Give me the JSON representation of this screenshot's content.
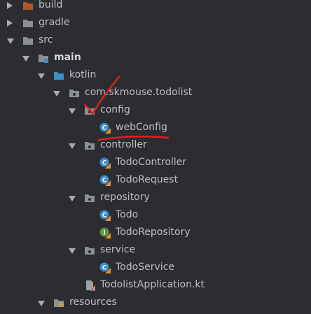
{
  "tree": {
    "nodes": [
      {
        "label": "build",
        "arrow": "collapsed",
        "icon": "folder-excluded-icon",
        "bold": false
      },
      {
        "label": "gradle",
        "arrow": "collapsed",
        "icon": "folder-icon",
        "bold": false
      },
      {
        "label": "src",
        "arrow": "expanded",
        "icon": "folder-icon",
        "bold": false
      },
      {
        "label": "main",
        "arrow": "expanded",
        "icon": "module-folder-icon",
        "bold": true
      },
      {
        "label": "kotlin",
        "arrow": "expanded",
        "icon": "source-folder-icon",
        "bold": false
      },
      {
        "label": "com.skmouse.todolist",
        "arrow": "expanded",
        "icon": "package-icon",
        "bold": false
      },
      {
        "label": "config",
        "arrow": "expanded",
        "icon": "package-icon",
        "bold": false
      },
      {
        "label": "webConfig",
        "arrow": "none",
        "icon": "kotlin-class-icon",
        "bold": false
      },
      {
        "label": "controller",
        "arrow": "expanded",
        "icon": "package-icon",
        "bold": false
      },
      {
        "label": "TodoController",
        "arrow": "none",
        "icon": "kotlin-class-icon",
        "bold": false
      },
      {
        "label": "TodoRequest",
        "arrow": "none",
        "icon": "kotlin-class-icon",
        "bold": false
      },
      {
        "label": "repository",
        "arrow": "expanded",
        "icon": "package-icon",
        "bold": false
      },
      {
        "label": "Todo",
        "arrow": "none",
        "icon": "kotlin-class-icon",
        "bold": false
      },
      {
        "label": "TodoRepository",
        "arrow": "none",
        "icon": "kotlin-interface-icon",
        "bold": false
      },
      {
        "label": "service",
        "arrow": "expanded",
        "icon": "package-icon",
        "bold": false
      },
      {
        "label": "TodoService",
        "arrow": "none",
        "icon": "kotlin-class-icon",
        "bold": false
      },
      {
        "label": "TodolistApplication.kt",
        "arrow": "none",
        "icon": "kotlin-file-icon",
        "bold": false
      },
      {
        "label": "resources",
        "arrow": "expanded",
        "icon": "resources-folder-icon",
        "bold": false
      }
    ]
  },
  "colors": {
    "background": "#2b2d30",
    "text": "#bcbec4",
    "folder": "#8c8f94",
    "excluded_folder": "#b5552a",
    "source_folder": "#3d8fc4",
    "class_badge": "#3b8bc8",
    "interface_badge": "#5f9447",
    "kotlin_orange": "#f08d2a",
    "annotation": "#e02020"
  }
}
